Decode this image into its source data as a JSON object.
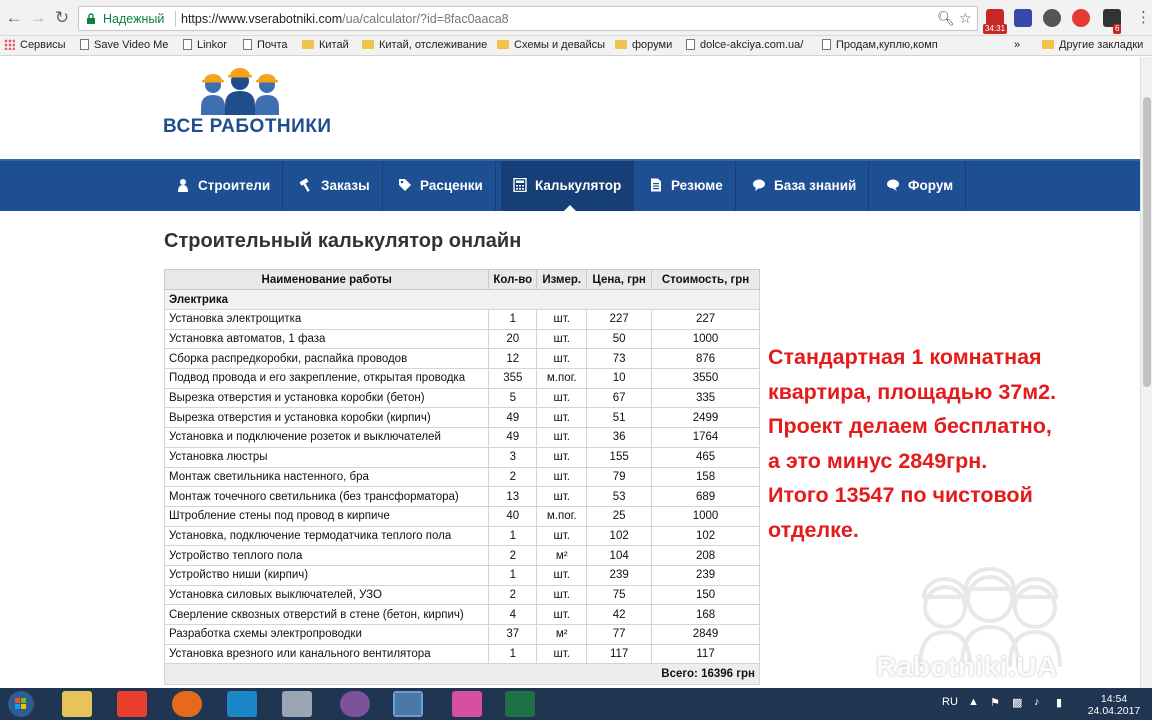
{
  "browser": {
    "secure_label": "Надежный",
    "url_base": "https://www.vserabotniki.com",
    "url_path": "/ua/calculator/?id=8fac0aaca8",
    "ext_badge": "34:31",
    "ext_badge2": "6"
  },
  "bookmarks": [
    {
      "label": "Сервисы",
      "icon": "apps-icon"
    },
    {
      "label": "Save Video Me",
      "icon": "page-icon"
    },
    {
      "label": "Linkor",
      "icon": "page-icon"
    },
    {
      "label": "Почта",
      "icon": "page-icon"
    },
    {
      "label": "Китай",
      "icon": "folder-icon"
    },
    {
      "label": "Китай, отслеживание",
      "icon": "folder-icon"
    },
    {
      "label": "Схемы и девайсы",
      "icon": "folder-icon"
    },
    {
      "label": "форуми",
      "icon": "folder-icon"
    },
    {
      "label": "dolce-akciya.com.ua/",
      "icon": "page-icon"
    },
    {
      "label": "Продам,куплю,комп",
      "icon": "page-icon"
    },
    {
      "label": "»",
      "icon": ""
    },
    {
      "label": "Другие закладки",
      "icon": "folder-icon"
    }
  ],
  "site": {
    "logo_text": "ВСЕ РАБОТНИКИ",
    "nav": [
      {
        "label": "Строители",
        "icon": "worker-icon"
      },
      {
        "label": "Заказы",
        "icon": "hammer-icon"
      },
      {
        "label": "Расценки",
        "icon": "tag-icon"
      },
      {
        "label": "Калькулятор",
        "icon": "calculator-icon",
        "active": true
      },
      {
        "label": "Резюме",
        "icon": "document-icon"
      },
      {
        "label": "База знаний",
        "icon": "chat-icon"
      },
      {
        "label": "Форум",
        "icon": "forum-icon"
      }
    ],
    "page_title": "Строительный калькулятор онлайн"
  },
  "table": {
    "headers": [
      "Наименование работы",
      "Кол-во",
      "Измер.",
      "Цена, грн",
      "Стоимость, грн"
    ],
    "section": "Электрика",
    "rows": [
      [
        "Установка электрощитка",
        "1",
        "шт.",
        "227",
        "227"
      ],
      [
        "Установка автоматов, 1 фаза",
        "20",
        "шт.",
        "50",
        "1000"
      ],
      [
        "Сборка распредкоробки, распайка проводов",
        "12",
        "шт.",
        "73",
        "876"
      ],
      [
        "Подвод провода и его закрепление, открытая проводка",
        "355",
        "м.пог.",
        "10",
        "3550"
      ],
      [
        "Вырезка отверстия и установка коробки (бетон)",
        "5",
        "шт.",
        "67",
        "335"
      ],
      [
        "Вырезка отверстия и установка коробки (кирпич)",
        "49",
        "шт.",
        "51",
        "2499"
      ],
      [
        "Установка и подключение розеток и выключателей",
        "49",
        "шт.",
        "36",
        "1764"
      ],
      [
        "Установка люстры",
        "3",
        "шт.",
        "155",
        "465"
      ],
      [
        "Монтаж светильника настенного, бра",
        "2",
        "шт.",
        "79",
        "158"
      ],
      [
        "Монтаж точечного светильника (без трансформатора)",
        "13",
        "шт.",
        "53",
        "689"
      ],
      [
        "Штробление стены под провод в кирпиче",
        "40",
        "м.пог.",
        "25",
        "1000"
      ],
      [
        "Установка, подключение термодатчика теплого пола",
        "1",
        "шт.",
        "102",
        "102"
      ],
      [
        "Устройство теплого пола",
        "2",
        "м²",
        "104",
        "208"
      ],
      [
        "Устройство ниши (кирпич)",
        "1",
        "шт.",
        "239",
        "239"
      ],
      [
        "Установка силовых выключателей, УЗО",
        "2",
        "шт.",
        "75",
        "150"
      ],
      [
        "Сверление сквозных отверстий в стене (бетон, кирпич)",
        "4",
        "шт.",
        "42",
        "168"
      ],
      [
        "Разработка схемы электропроводки",
        "37",
        "м²",
        "77",
        "2849"
      ],
      [
        "Установка врезного или канального вентилятора",
        "1",
        "шт.",
        "117",
        "117"
      ]
    ],
    "total": "Всего: 16396 грн"
  },
  "annotation": [
    "Стандартная 1 комнатная",
    "квартира, площадью 37м2.",
    "Проект делаем бесплатно,",
    "а это минус 2849грн.",
    "Итого 13547 по чистовой",
    "отделке."
  ],
  "watermark": "Rabotniki.UA",
  "taskbar": {
    "lang": "RU",
    "time": "14:54",
    "date": "24.04.2017"
  },
  "colors": {
    "nav_bg": "#1d4f92",
    "annotation": "#e31b1b",
    "logo": "#1f4e8c"
  }
}
